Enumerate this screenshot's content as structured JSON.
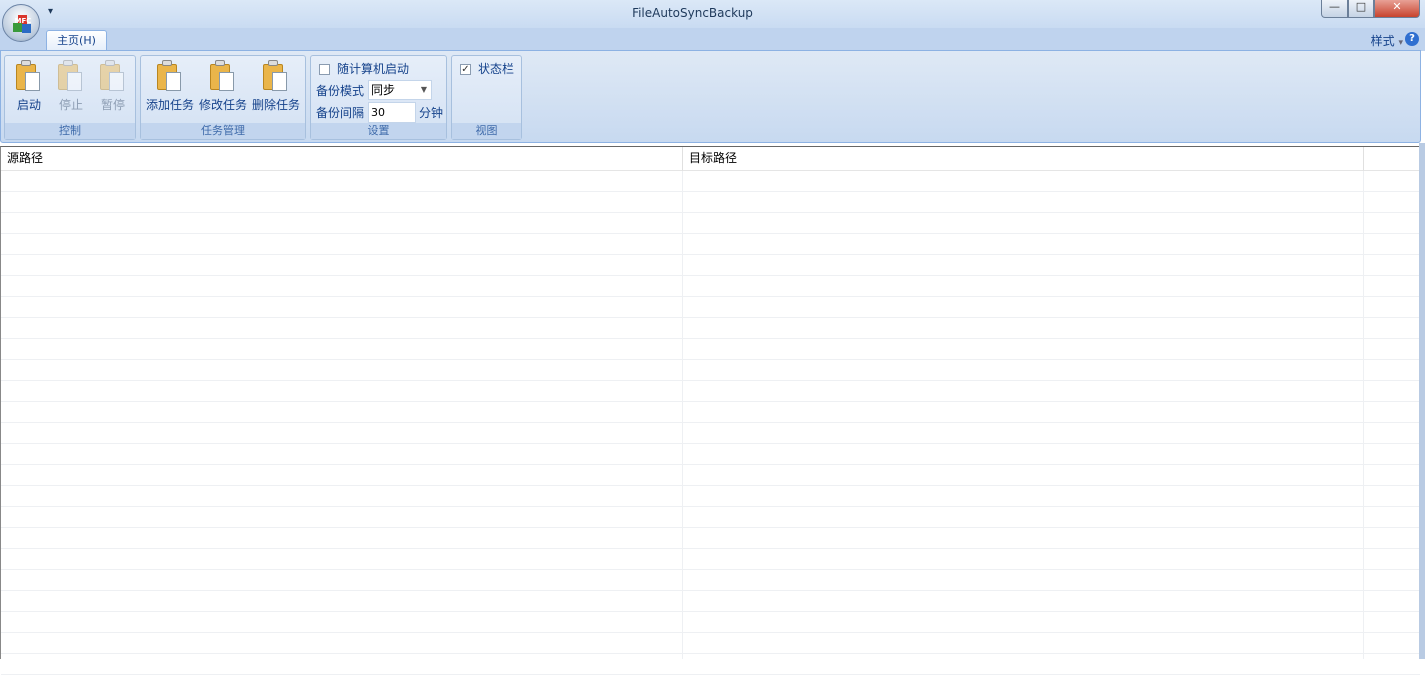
{
  "window": {
    "title": "FileAutoSyncBackup",
    "minimize": "—",
    "maximize": "□",
    "close": "✕"
  },
  "app_button": {
    "letters": "MFC"
  },
  "qat_label": "▾",
  "tabs": [
    {
      "label": "主页(H)"
    }
  ],
  "style_menu": {
    "label": "样式",
    "arrow": "▾",
    "help": "?"
  },
  "groups": {
    "control": {
      "label": "控制",
      "buttons": [
        {
          "label": "启动",
          "enabled": true
        },
        {
          "label": "停止",
          "enabled": false
        },
        {
          "label": "暂停",
          "enabled": false
        }
      ]
    },
    "task": {
      "label": "任务管理",
      "buttons": [
        {
          "label": "添加任务"
        },
        {
          "label": "修改任务"
        },
        {
          "label": "删除任务"
        }
      ]
    },
    "settings": {
      "label": "设置",
      "autostart_label": "随计算机启动",
      "autostart_checked": false,
      "mode_label": "备份模式",
      "mode_value": "同步",
      "interval_label": "备份间隔",
      "interval_value": "30",
      "interval_unit": "分钟"
    },
    "view": {
      "label": "视图",
      "statusbar_label": "状态栏",
      "statusbar_checked": true,
      "check": "✓"
    }
  },
  "table": {
    "columns": [
      "源路径",
      "目标路径",
      ""
    ],
    "rows": []
  }
}
